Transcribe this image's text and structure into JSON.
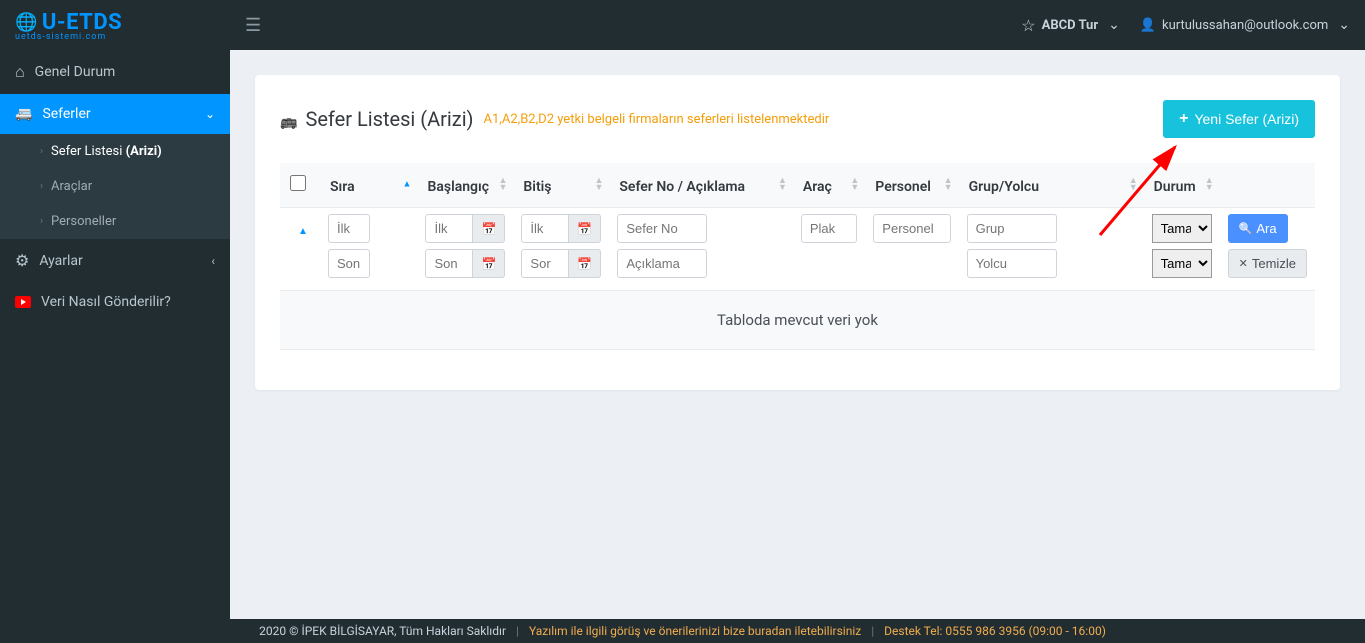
{
  "brand": {
    "name": "U-ETDS",
    "sub": "uetds-sistemi.com"
  },
  "topbar": {
    "company": "ABCD Tur",
    "user": "kurtulussahan@outlook.com"
  },
  "sidebar": {
    "genel": "Genel Durum",
    "seferler": "Seferler",
    "sefer_listesi_pre": "Sefer Listesi ",
    "sefer_listesi_bold": "(Arizi)",
    "araclar": "Araçlar",
    "personeller": "Personeller",
    "ayarlar": "Ayarlar",
    "video": "Veri Nasıl Gönderilir?"
  },
  "page": {
    "title": "Sefer Listesi (Arizi)",
    "subtitle": "A1,A2,B2,D2 yetki belgeli firmaların seferleri listelenmektedir",
    "new_button": "Yeni Sefer (Arizi)"
  },
  "columns": {
    "sira": "Sıra",
    "baslangic": "Başlangıç",
    "bitis": "Bitiş",
    "seferno": "Sefer No / Açıklama",
    "arac": "Araç",
    "personel": "Personel",
    "grup": "Grup/Yolcu",
    "durum": "Durum"
  },
  "filters": {
    "ilk": "İlk",
    "son": "Son",
    "sor": "Sor",
    "seferno": "Sefer No",
    "aciklama": "Açıklama",
    "plaka": "Plak",
    "personel": "Personel",
    "grup": "Grup",
    "yolcu": "Yolcu",
    "durum_sel": "Tamamı",
    "ara": "Ara",
    "temizle": "Temizle"
  },
  "table": {
    "empty": "Tabloda mevcut veri yok"
  },
  "footer": {
    "copyright": "2020 © İPEK BİLGİSAYAR, Tüm Hakları Saklıdır",
    "feedback": "Yazılım ile ilgili görüş ve önerilerinizi bize buradan iletebilirsiniz",
    "support": "Destek Tel: 0555 986 3956 (09:00 - 16:00)"
  }
}
